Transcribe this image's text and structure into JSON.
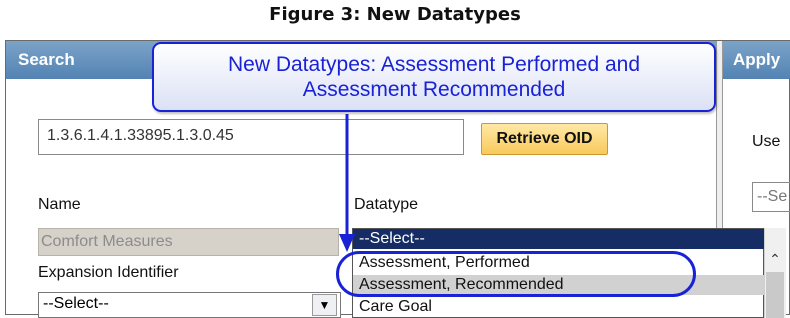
{
  "figure_caption": "Figure 3: New Datatypes",
  "panel": {
    "search_header": "Search",
    "apply_header": "Apply"
  },
  "oid_input": {
    "value": "1.3.6.1.4.1.33895.1.3.0.45"
  },
  "retrieve_button": "Retrieve OID",
  "use_label": "Use",
  "right_select": "--Se",
  "name": {
    "label": "Name",
    "value": "Comfort Measures"
  },
  "datatype": {
    "label": "Datatype",
    "selected": "--Select--",
    "options": [
      "Assessment, Performed",
      "Assessment, Recommended",
      "Care Goal"
    ]
  },
  "expansion": {
    "label": "Expansion Identifier",
    "value": "--Select--"
  },
  "callout": {
    "line1": "New Datatypes: Assessment Performed and",
    "line2": "Assessment Recommended"
  },
  "colors": {
    "header_blue": "#5f8fbf",
    "selected_option": "#152c64",
    "highlight_option": "#d1d1d1",
    "callout_blue": "#1a22d6",
    "button_gold": "#f8c95b"
  }
}
